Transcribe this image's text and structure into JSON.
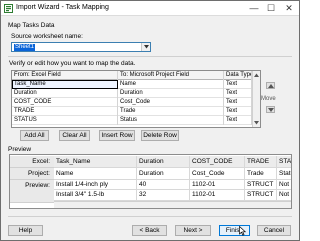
{
  "window": {
    "title": "Import Wizard - Task Mapping",
    "minimize_glyph": "—",
    "maximize_glyph": "☐",
    "close_glyph": "✕"
  },
  "map_section": {
    "title": "Map Tasks Data",
    "source_label": "Source worksheet name:",
    "source_value": "Sheet1",
    "instructions": "Verify or edit how you want to map the data."
  },
  "mapping_table": {
    "headers": [
      "From: Excel Field",
      "To: Microsoft Project Field",
      "Data Type"
    ],
    "rows": [
      [
        "Task_Name",
        "Name",
        "Text"
      ],
      [
        "Duration",
        "Duration",
        "Text"
      ],
      [
        "COST_CODE",
        "Cost_Code",
        "Text"
      ],
      [
        "TRADE",
        "Trade",
        "Text"
      ],
      [
        "STATUS",
        "Status",
        "Text"
      ]
    ]
  },
  "move": {
    "label": "Move"
  },
  "table_buttons": {
    "add_all": "Add All",
    "clear_all": "Clear All",
    "insert_row": "Insert Row",
    "delete_row": "Delete Row"
  },
  "preview": {
    "title": "Preview",
    "row_labels": [
      "Excel:",
      "Project:",
      "Preview:"
    ],
    "excel": [
      "Task_Name",
      "Duration",
      "COST_CODE",
      "TRADE",
      "STATUS"
    ],
    "project": [
      "Name",
      "Duration",
      "Cost_Code",
      "Trade",
      "Status"
    ],
    "rows": [
      [
        "Install 1/4-inch ply",
        "40",
        "1102-01",
        "STRUCT",
        "Not S"
      ],
      [
        "Install 3/4\" 1.5-lb",
        "32",
        "1102-01",
        "STRUCT",
        "Not S"
      ]
    ]
  },
  "footer": {
    "help": "Help",
    "back": "< Back",
    "next": "Next >",
    "finish": "Finish",
    "cancel": "Cancel"
  },
  "colors": {
    "selection": "#0a64d8",
    "focus_border": "#0078d7"
  },
  "icons": [
    "app-icon",
    "combo-arrow-icon",
    "move-up-icon",
    "move-down-icon",
    "scroll-up-icon",
    "scroll-down-icon",
    "mouse-cursor-icon"
  ]
}
